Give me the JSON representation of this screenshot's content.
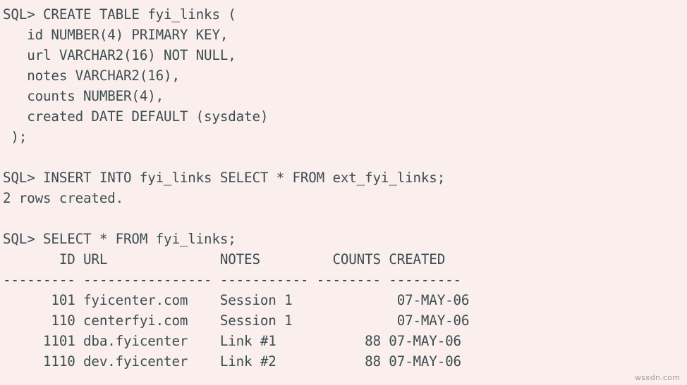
{
  "terminal": {
    "prompt": "SQL> ",
    "background_color": "#faefed",
    "text_color": "#3c4d52",
    "lines": [
      "SQL> CREATE TABLE fyi_links (",
      "   id NUMBER(4) PRIMARY KEY,",
      "   url VARCHAR2(16) NOT NULL,",
      "   notes VARCHAR2(16),",
      "   counts NUMBER(4),",
      "   created DATE DEFAULT (sysdate)",
      " );",
      "",
      "SQL> INSERT INTO fyi_links SELECT * FROM ext_fyi_links;",
      "2 rows created.",
      "",
      "SQL> SELECT * FROM fyi_links;",
      "       ID URL              NOTES         COUNTS CREATED",
      "--------- ---------------- ----------- -------- ---------",
      "      101 fyicenter.com    Session 1             07-MAY-06",
      "      110 centerfyi.com    Session 1             07-MAY-06",
      "     1101 dba.fyicenter    Link #1           88 07-MAY-06",
      "     1110 dev.fyicenter    Link #2           88 07-MAY-06"
    ],
    "statements": {
      "create_table": "CREATE TABLE fyi_links (",
      "insert_select": "INSERT INTO fyi_links SELECT * FROM ext_fyi_links;",
      "select_all": "SELECT * FROM fyi_links;"
    },
    "messages": {
      "rows_created": "2 rows created."
    },
    "result_table": {
      "columns": [
        "ID",
        "URL",
        "NOTES",
        "COUNTS",
        "CREATED"
      ],
      "separator_widths": [
        9,
        16,
        11,
        8,
        9
      ],
      "rows": [
        {
          "ID": "101",
          "URL": "fyicenter.com",
          "NOTES": "Session 1",
          "COUNTS": "",
          "CREATED": "07-MAY-06"
        },
        {
          "ID": "110",
          "URL": "centerfyi.com",
          "NOTES": "Session 1",
          "COUNTS": "",
          "CREATED": "07-MAY-06"
        },
        {
          "ID": "1101",
          "URL": "dba.fyicenter",
          "NOTES": "Link #1",
          "COUNTS": "88",
          "CREATED": "07-MAY-06"
        },
        {
          "ID": "1110",
          "URL": "dev.fyicenter",
          "NOTES": "Link #2",
          "COUNTS": "88",
          "CREATED": "07-MAY-06"
        }
      ]
    }
  },
  "watermark": {
    "text": "wsxdn.com"
  }
}
